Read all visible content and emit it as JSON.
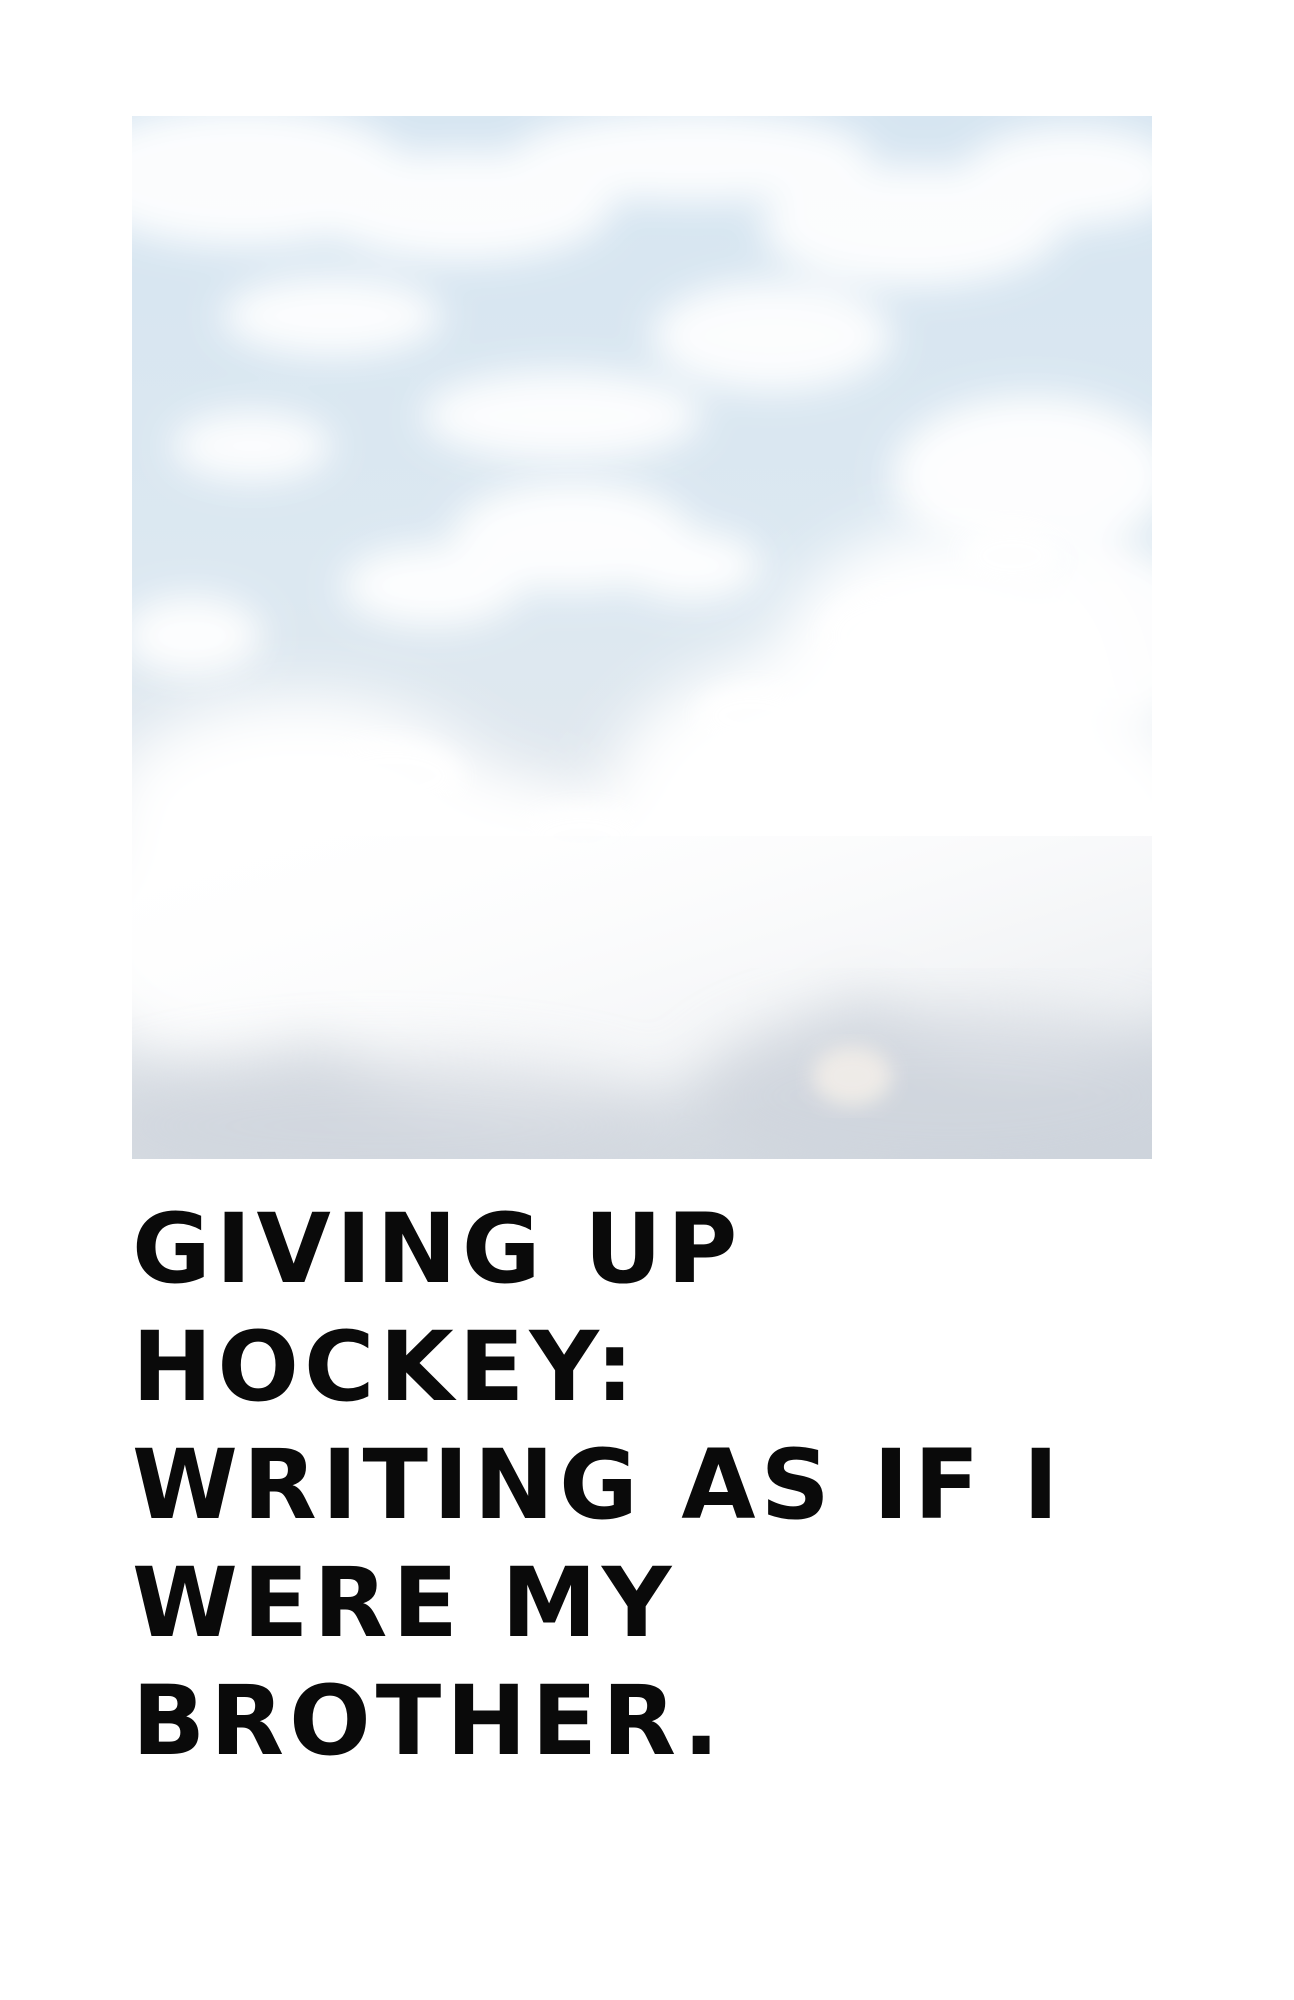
{
  "image": {
    "icon": "cloudy-sky-photo",
    "sky_color": "#cfe0ee",
    "cloud_color": "#ffffff",
    "shade_color": "#d4d9e0"
  },
  "title": {
    "lines": [
      "GIVING UP",
      "HOCKEY:",
      "WRITING AS IF I",
      "WERE MY",
      "BROTHER."
    ],
    "color": "#0a0a0a"
  }
}
